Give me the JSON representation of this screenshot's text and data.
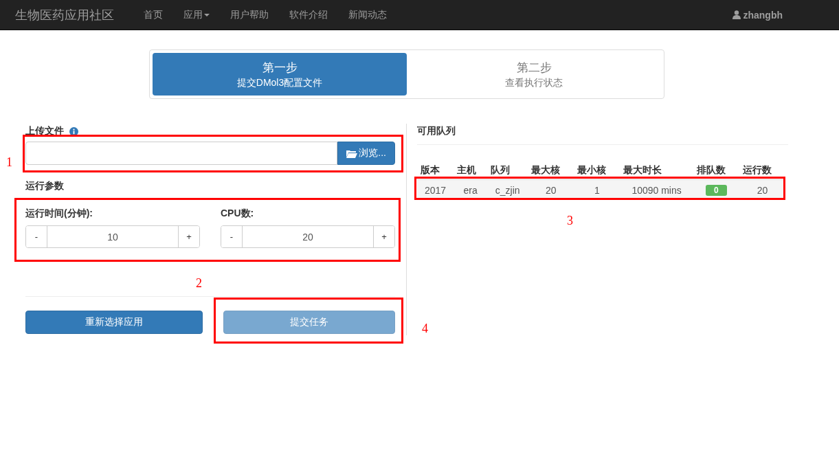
{
  "navbar": {
    "brand": "生物医药应用社区",
    "items": [
      {
        "label": "首页",
        "dropdown": false
      },
      {
        "label": "应用",
        "dropdown": true
      },
      {
        "label": "用户帮助",
        "dropdown": false
      },
      {
        "label": "软件介绍",
        "dropdown": false
      },
      {
        "label": "新闻动态",
        "dropdown": false
      }
    ],
    "user": "zhangbh"
  },
  "steps": [
    {
      "title": "第一步",
      "subtitle": "提交DMol3配置文件",
      "selected": true
    },
    {
      "title": "第二步",
      "subtitle": "查看执行状态",
      "selected": false
    }
  ],
  "upload": {
    "label": "上传文件",
    "browse_button": "浏览...",
    "annotation": "1"
  },
  "params": {
    "title": "运行参数",
    "annotation": "2",
    "fields": [
      {
        "label": "运行时间(分钟):",
        "decrement": "-",
        "value": "10",
        "increment": "+"
      },
      {
        "label": "CPU数:",
        "decrement": "-",
        "value": "20",
        "increment": "+"
      }
    ]
  },
  "actions": {
    "reselect_button": "重新选择应用",
    "submit_button": {
      "label": "提交任务",
      "disabled": true
    },
    "annotation": "4"
  },
  "queues": {
    "title": "可用队列",
    "annotation": "3",
    "columns": [
      "版本",
      "主机",
      "队列",
      "最大核",
      "最小核",
      "最大时长",
      "排队数",
      "运行数"
    ],
    "rows": [
      {
        "cells": [
          {
            "kind": "text",
            "text": "2017"
          },
          {
            "kind": "text",
            "text": "era"
          },
          {
            "kind": "text",
            "text": "c_zjin"
          },
          {
            "kind": "text",
            "text": "20"
          },
          {
            "kind": "text",
            "text": "1"
          },
          {
            "kind": "text",
            "text": "10090 mins"
          },
          {
            "kind": "badge",
            "text": "0"
          },
          {
            "kind": "text",
            "text": "20"
          }
        ]
      }
    ]
  }
}
